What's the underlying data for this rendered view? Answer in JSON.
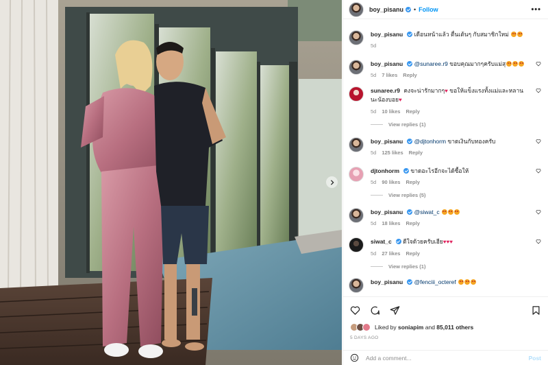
{
  "header": {
    "username": "boy_pisanu",
    "follow_label": "Follow",
    "separator": "•",
    "more_label": "•••"
  },
  "caption": {
    "username": "boy_pisanu",
    "text": "เดือนหน้าแล้ว ตื่นเต้นๆ กับสมาชิกใหม่",
    "time": "5d"
  },
  "comments": [
    {
      "username": "boy_pisanu",
      "mention": "@sunaree.r9",
      "text": "ขอบคุณมากๆครับแม่สุ",
      "time": "5d",
      "likes": "7 likes",
      "reply": "Reply",
      "emojis": 3
    },
    {
      "username": "sunaree.r9",
      "mention": "",
      "text": "คงจะน่ารักมากๆ",
      "text2": "ขอให้แข็งแรงทั้งแม่และหลานนะน้องบอย",
      "time": "5d",
      "likes": "10 likes",
      "reply": "Reply",
      "view_replies": "View replies (1)"
    },
    {
      "username": "boy_pisanu",
      "mention": "@djtonhorm",
      "text": "ขาดเงินกับทองครับ",
      "time": "5d",
      "likes": "125 likes",
      "reply": "Reply"
    },
    {
      "username": "djtonhorm",
      "mention": "",
      "text": "ขาดอะไรอีกจะได้ซื้อให้",
      "time": "5d",
      "likes": "90 likes",
      "reply": "Reply",
      "view_replies": "View replies (5)"
    },
    {
      "username": "boy_pisanu",
      "mention": "@siwat_c",
      "text": "",
      "time": "5d",
      "likes": "18 likes",
      "reply": "Reply",
      "emojis": 3
    },
    {
      "username": "siwat_c",
      "mention": "",
      "text": "ดีใจด้วยครับเฮีย",
      "time": "5d",
      "likes": "27 likes",
      "reply": "Reply",
      "view_replies": "View replies (1)"
    },
    {
      "username": "boy_pisanu",
      "mention": "@fenciii_octeref",
      "text": "",
      "time": "",
      "likes": "",
      "reply": ""
    }
  ],
  "likes_summary": {
    "prefix": "Liked by",
    "user": "soniapim",
    "middle": "and",
    "count": "85,011 others"
  },
  "time_ago": "5 DAYS AGO",
  "add_comment": {
    "placeholder": "Add a comment...",
    "post_label": "Post"
  },
  "colors": {
    "link_blue": "#0095f6",
    "verified": "#3897f0",
    "muted": "#8e8e8e",
    "heart": "#e0245e"
  },
  "icons": [
    "heart-icon",
    "comment-icon",
    "share-icon",
    "bookmark-icon",
    "emoji-icon",
    "verified-icon",
    "chevron-right-icon"
  ]
}
